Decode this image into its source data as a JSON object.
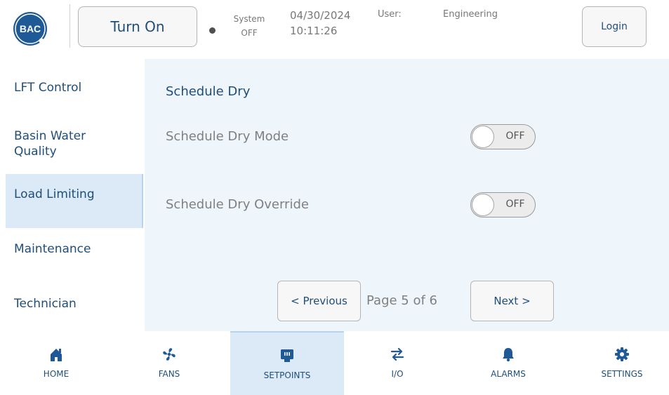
{
  "header": {
    "logo_text": "BAC",
    "turn_on_label": "Turn On",
    "system_label": "System",
    "system_value": "OFF",
    "date": "04/30/2024",
    "time": "10:11:26",
    "user_label": "User:",
    "user_value": "Engineering",
    "login_label": "Login"
  },
  "sidebar": {
    "items": [
      {
        "label": "LFT Control"
      },
      {
        "label": "Basin Water Quality"
      },
      {
        "label": "Load Limiting",
        "active": true
      },
      {
        "label": "Maintenance"
      },
      {
        "label": "Technician"
      }
    ]
  },
  "main": {
    "section_title": "Schedule Dry",
    "settings": [
      {
        "label": "Schedule Dry Mode",
        "state": "OFF"
      },
      {
        "label": "Schedule Dry Override",
        "state": "OFF"
      }
    ],
    "prev_label": "< Previous",
    "page_indicator": "Page 5 of 6",
    "next_label": "Next >"
  },
  "bottom_nav": {
    "items": [
      {
        "label": "HOME",
        "icon": "home-icon"
      },
      {
        "label": "FANS",
        "icon": "fan-icon"
      },
      {
        "label": "SETPOINTS",
        "icon": "setpoints-icon",
        "active": true
      },
      {
        "label": "I/O",
        "icon": "io-arrows-icon"
      },
      {
        "label": "ALARMS",
        "icon": "bell-icon"
      },
      {
        "label": "SETTINGS",
        "icon": "gear-icon"
      }
    ]
  },
  "colors": {
    "brand": "#1f5a96",
    "text_primary": "#1f4e79",
    "text_muted": "#808080",
    "panel_bg": "#eef5fb",
    "active_bg": "#dceaf7"
  }
}
